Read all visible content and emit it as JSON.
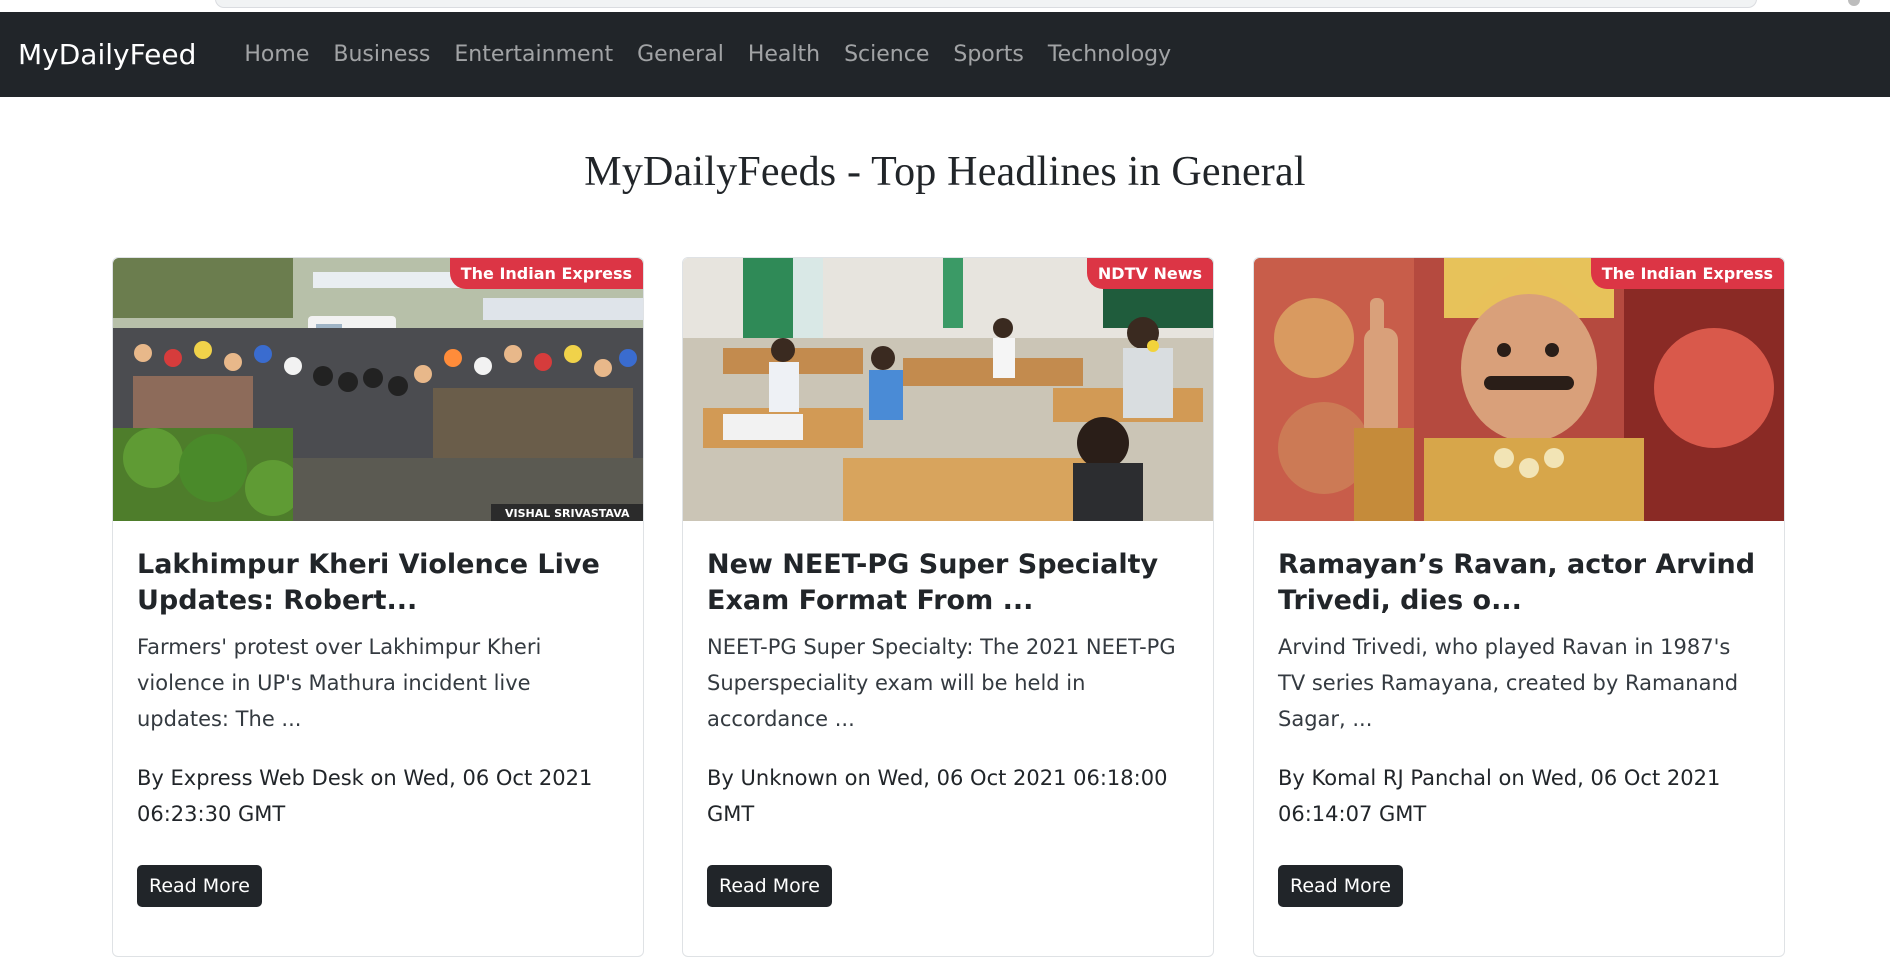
{
  "navbar": {
    "brand": "MyDailyFeed",
    "links": [
      "Home",
      "Business",
      "Entertainment",
      "General",
      "Health",
      "Science",
      "Sports",
      "Technology"
    ]
  },
  "page": {
    "title": "MyDailyFeeds - Top Headlines in General"
  },
  "articles": [
    {
      "source": "The Indian Express",
      "title": "Lakhimpur Kheri Violence Live Updates: Robert...",
      "description": "Farmers' protest over Lakhimpur Kheri violence in UP's Mathura incident live updates: The ...",
      "meta": "By Express Web Desk on Wed, 06 Oct 2021 06:23:30 GMT",
      "button": "Read More",
      "photo_credit": "VISHAL SRIVASTAVA"
    },
    {
      "source": "NDTV News",
      "title": "New NEET-PG Super Specialty Exam Format From ...",
      "description": "NEET-PG Super Specialty: The 2021 NEET-PG Superspeciality exam will be held in accordance ...",
      "meta": "By Unknown on Wed, 06 Oct 2021 06:18:00 GMT",
      "button": "Read More"
    },
    {
      "source": "The Indian Express",
      "title": "Ramayan’s Ravan, actor Arvind Trivedi, dies o...",
      "description": "Arvind Trivedi, who played Ravan in 1987's TV series Ramayana, created by Ramanand Sagar, ...",
      "meta": "By Komal RJ Panchal on Wed, 06 Oct 2021 06:14:07 GMT",
      "button": "Read More"
    }
  ],
  "colors": {
    "navbar": "#212529",
    "badge": "#dc3545",
    "button": "#212529"
  }
}
